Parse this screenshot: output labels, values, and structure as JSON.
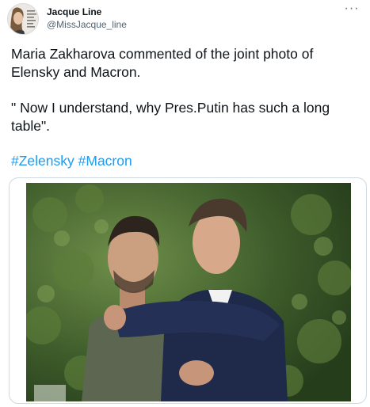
{
  "author": {
    "display_name": "Jacque Line",
    "handle": "@MissJacque_line",
    "avatar_icon": "profile-avatar"
  },
  "menu": {
    "more_label": "···"
  },
  "tweet": {
    "paragraph_1": "Maria Zakharova commented of the joint photo of Elensky and Macron.",
    "paragraph_2": "\" Now I understand, why Pres.Putin has such a long table\".",
    "hashtags": [
      "#Zelensky",
      "#Macron"
    ]
  },
  "media": {
    "type": "photo"
  },
  "colors": {
    "link": "#1d9bf0",
    "text": "#0f1419",
    "secondary_text": "#536471",
    "border": "#cfd9de"
  }
}
